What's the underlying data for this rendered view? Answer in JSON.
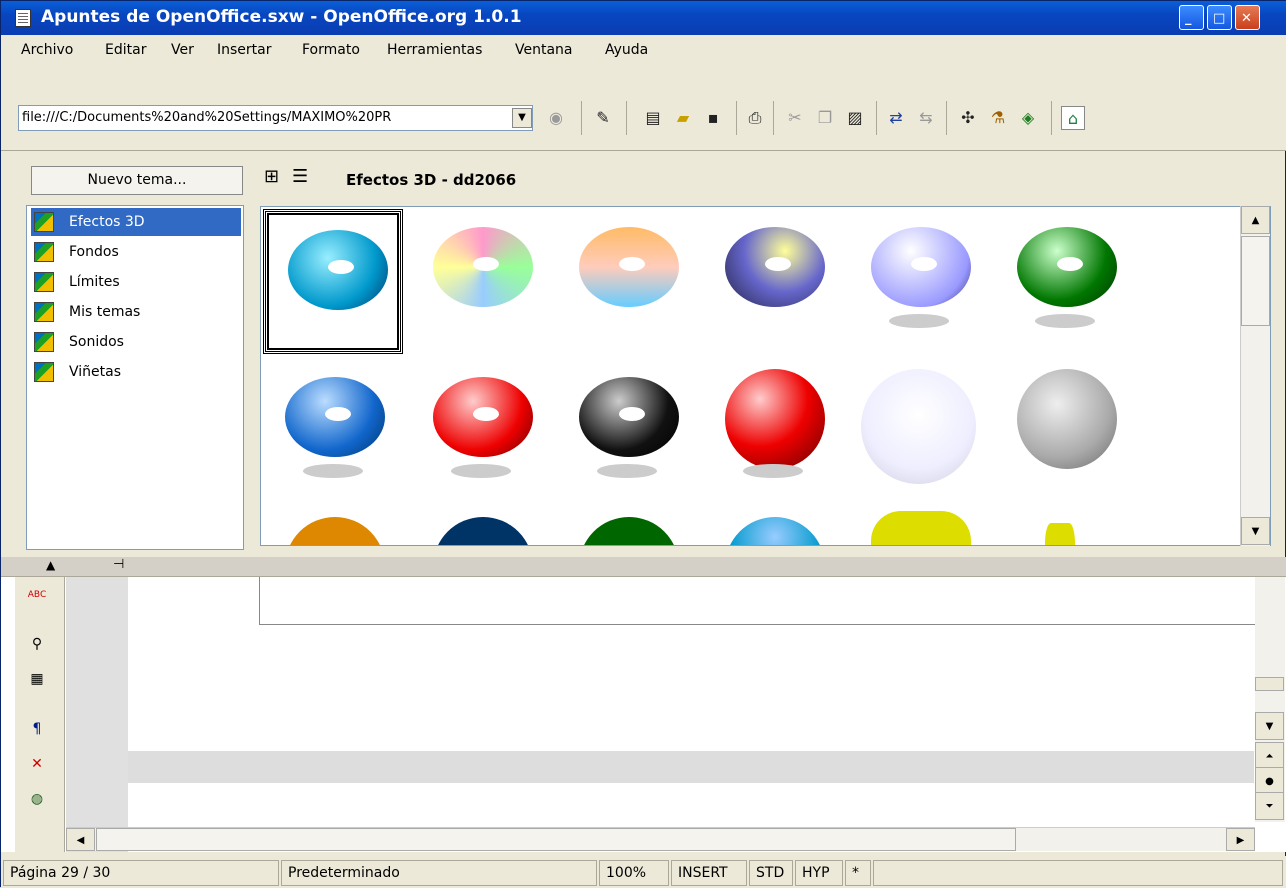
{
  "window": {
    "title": "Apuntes de OpenOffice.sxw - OpenOffice.org 1.0.1"
  },
  "menu": [
    "Archivo",
    "Editar",
    "Ver",
    "Insertar",
    "Formato",
    "Herramientas",
    "Ventana",
    "Ayuda"
  ],
  "toolbar": {
    "url": "file:///C:/Documents%20and%20Settings/MAXIMO%20PR"
  },
  "gallery": {
    "new_theme_button": "Nuevo tema...",
    "title": "Efectos 3D - dd2066",
    "themes": [
      "Efectos 3D",
      "Fondos",
      "Límites",
      "Mis temas",
      "Sonidos",
      "Viñetas"
    ],
    "selected_theme": "Efectos 3D"
  },
  "status": {
    "page": "Página 29 / 30",
    "style": "Predeterminado",
    "zoom": "100%",
    "mode": "INSERT",
    "sel": "STD",
    "hyp": "HYP",
    "modified": "*"
  }
}
